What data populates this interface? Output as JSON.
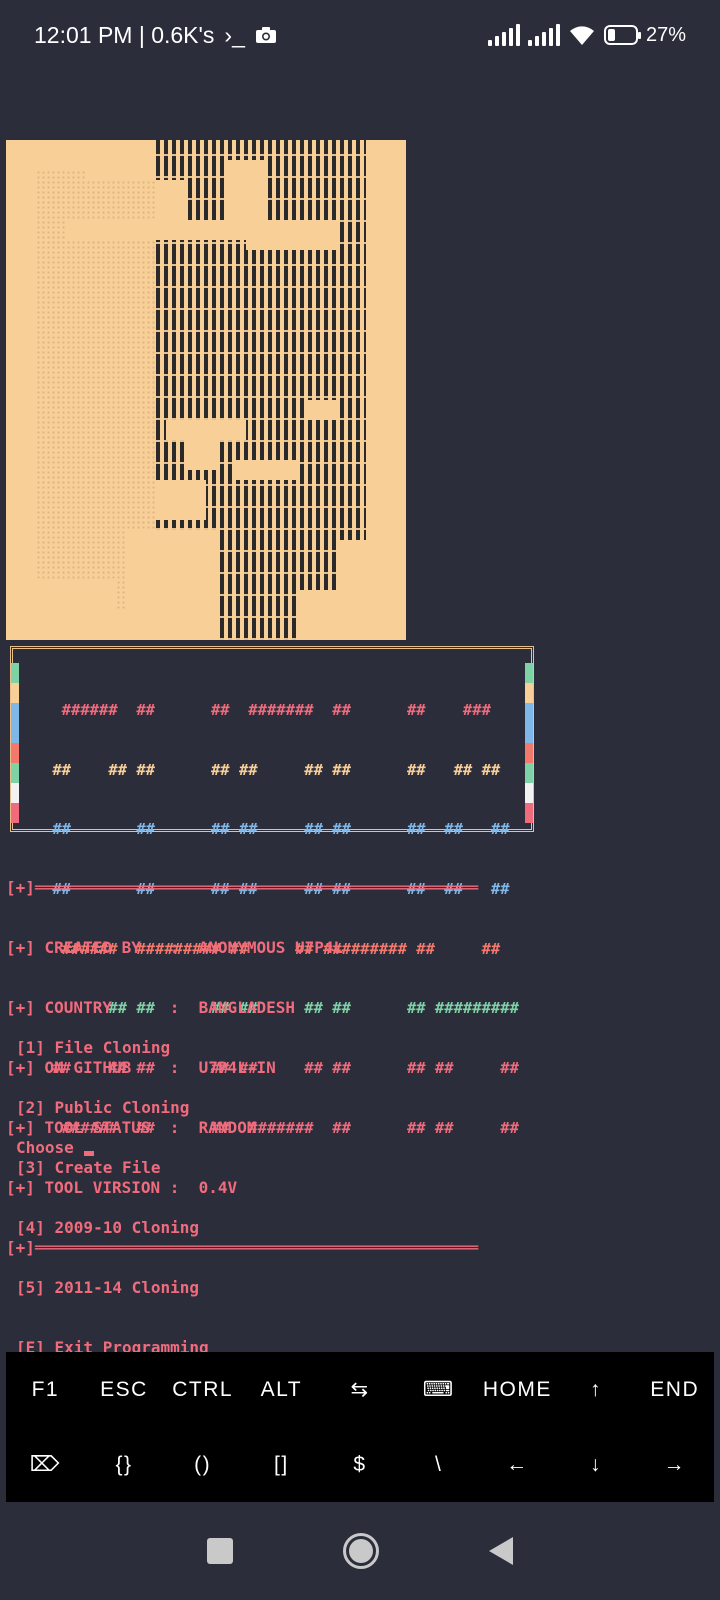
{
  "status_bar": {
    "time_info": "12:01 PM | 0.6K's",
    "terminal_glyph": "›_",
    "battery": "27%",
    "battery_level": 0.27
  },
  "logo": {
    "lines": [
      "  ######  ##      ##  #######  ##      ##    ###   ",
      " ##    ## ##      ## ##     ## ##      ##   ## ##  ",
      " ##       ##      ## ##     ## ##      ##  ##   ## ",
      " ##       ##      ## ##     ## ##      ##  ##   ## ",
      "  ######  ######### ##     ## ######### ##     ## ",
      "       ## ##      ## ##     ## ##      ## ######### ",
      " ##    ## ##      ## ##     ## ##      ## ##     ## ",
      "  ######  ##      ##  #######  ##      ## ##     ## "
    ],
    "side_colors": [
      "#7fd1a6",
      "#f9cf98",
      "#7fb8e8",
      "#7fb8e8",
      "#f4796d",
      "#7fd1a6",
      "#f2f2f2",
      "#f06b7c"
    ]
  },
  "info": {
    "divider_top": "[+]══════════════════════════════════════════════",
    "lines": [
      "[+] CREATED BY   :  ANONYMOUS U7P4L",
      "[+] COUNTRY      :  BANGLADESH",
      "[+] ON GITHUB    :  U7P4L-IN",
      "[+] TOOL STATUS  :  RANDOM",
      "[+] TOOL VIRSION :  0.4V"
    ],
    "divider_bottom": "[+]══════════════════════════════════════════════"
  },
  "menu": {
    "items": [
      "[1] File Cloning",
      "[2] Public Cloning",
      "[3] Create File",
      "[4] 2009-10 Cloning",
      "[5] 2011-14 Cloning",
      "[E] Exit Programming"
    ],
    "prompt": "Choose"
  },
  "extra_keys": {
    "row1": [
      "F1",
      "ESC",
      "CTRL",
      "ALT",
      "⇆",
      "⌨",
      "HOME",
      "↑",
      "END"
    ],
    "row2": [
      "⌦",
      "{}",
      "()",
      "[]",
      "$",
      "\\",
      "←",
      "↓",
      "→"
    ]
  }
}
